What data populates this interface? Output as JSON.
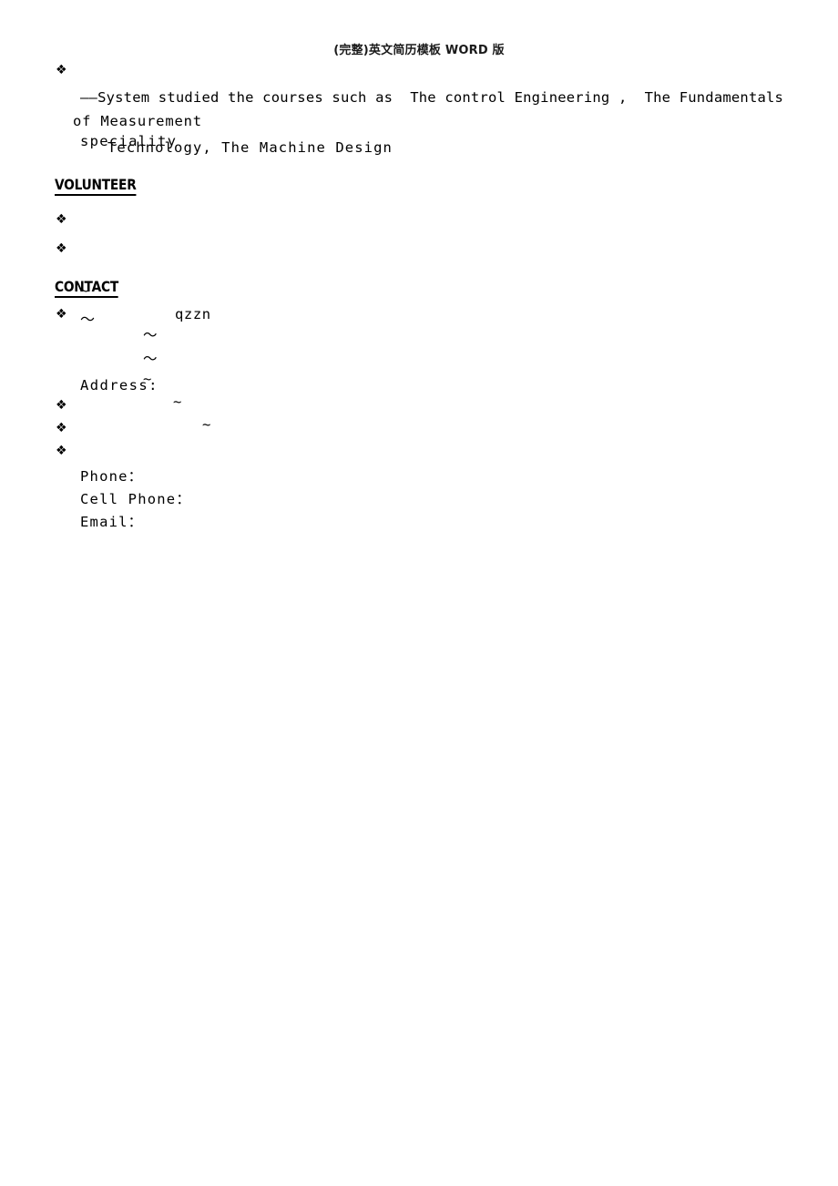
{
  "document": {
    "header": "(完整)英文简历模板 WORD 版",
    "bullet_glyph": "❖"
  },
  "speciality": {
    "bullet_label": "speciality",
    "detail_line1": "——System studied the courses such as  The control Engineering ,  The Fundamentals",
    "detail_line2": "of Measurement",
    "detail_line3": "Technology, The Machine Design"
  },
  "volunteer": {
    "heading": "VOLUNTEER",
    "items": [
      {
        "text": "~"
      },
      {
        "text": "～"
      }
    ]
  },
  "contact": {
    "heading": "CONTACT",
    "address": {
      "label": "Address:",
      "value": "qzzn",
      "extra_lines": [
        "～",
        "～",
        "~"
      ]
    },
    "phone": {
      "label": "Phone：",
      "value": "~"
    },
    "cell_phone": {
      "label": "Cell Phone：",
      "value": "~"
    },
    "email": {
      "label": "Email：",
      "value": ""
    }
  }
}
